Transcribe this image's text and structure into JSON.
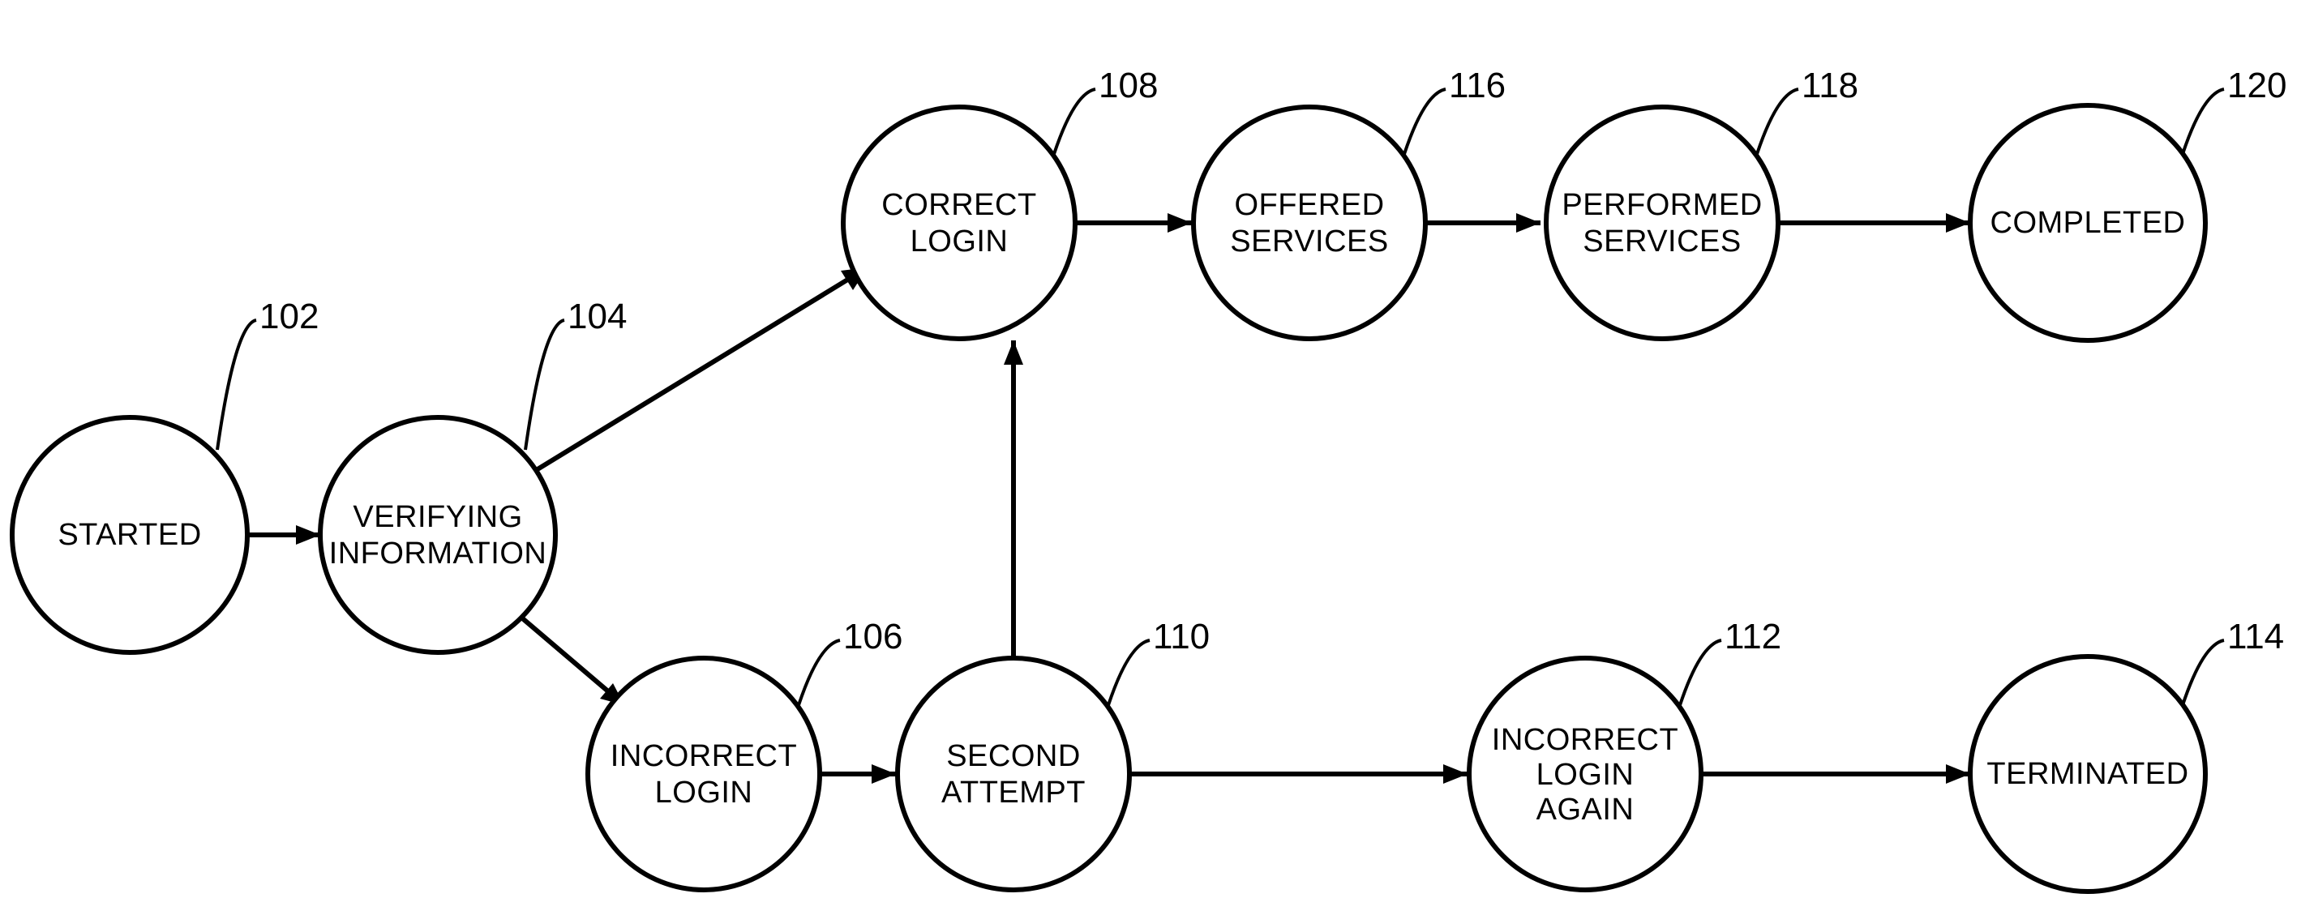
{
  "nodes": {
    "started": {
      "label_l1": "STARTED",
      "label_l2": "",
      "ref": "102"
    },
    "verifying": {
      "label_l1": "VERIFYING",
      "label_l2": "INFORMATION",
      "ref": "104"
    },
    "incorrect_login": {
      "label_l1": "INCORRECT",
      "label_l2": "LOGIN",
      "ref": "106"
    },
    "correct_login": {
      "label_l1": "CORRECT",
      "label_l2": "LOGIN",
      "ref": "108"
    },
    "second_attempt": {
      "label_l1": "SECOND",
      "label_l2": "ATTEMPT",
      "ref": "110"
    },
    "incorrect_again": {
      "label_l1": "INCORRECT",
      "label_l2": "LOGIN",
      "label_l3": "AGAIN",
      "ref": "112"
    },
    "terminated": {
      "label_l1": "TERMINATED",
      "label_l2": "",
      "ref": "114"
    },
    "offered_services": {
      "label_l1": "OFFERED",
      "label_l2": "SERVICES",
      "ref": "116"
    },
    "performed_services": {
      "label_l1": "PERFORMED",
      "label_l2": "SERVICES",
      "ref": "118"
    },
    "completed": {
      "label_l1": "COMPLETED",
      "label_l2": "",
      "ref": "120"
    }
  },
  "chart_data": {
    "type": "state-diagram",
    "states": [
      {
        "id": "started",
        "label": "STARTED",
        "ref": 102
      },
      {
        "id": "verifying",
        "label": "VERIFYING INFORMATION",
        "ref": 104
      },
      {
        "id": "incorrect_login",
        "label": "INCORRECT LOGIN",
        "ref": 106
      },
      {
        "id": "correct_login",
        "label": "CORRECT LOGIN",
        "ref": 108
      },
      {
        "id": "second_attempt",
        "label": "SECOND ATTEMPT",
        "ref": 110
      },
      {
        "id": "incorrect_again",
        "label": "INCORRECT LOGIN AGAIN",
        "ref": 112
      },
      {
        "id": "terminated",
        "label": "TERMINATED",
        "ref": 114
      },
      {
        "id": "offered_services",
        "label": "OFFERED SERVICES",
        "ref": 116
      },
      {
        "id": "performed_services",
        "label": "PERFORMED SERVICES",
        "ref": 118
      },
      {
        "id": "completed",
        "label": "COMPLETED",
        "ref": 120
      }
    ],
    "transitions": [
      {
        "from": "started",
        "to": "verifying"
      },
      {
        "from": "verifying",
        "to": "correct_login"
      },
      {
        "from": "verifying",
        "to": "incorrect_login"
      },
      {
        "from": "incorrect_login",
        "to": "second_attempt"
      },
      {
        "from": "second_attempt",
        "to": "correct_login"
      },
      {
        "from": "second_attempt",
        "to": "incorrect_again"
      },
      {
        "from": "incorrect_again",
        "to": "terminated"
      },
      {
        "from": "correct_login",
        "to": "offered_services"
      },
      {
        "from": "offered_services",
        "to": "performed_services"
      },
      {
        "from": "performed_services",
        "to": "completed"
      }
    ]
  }
}
